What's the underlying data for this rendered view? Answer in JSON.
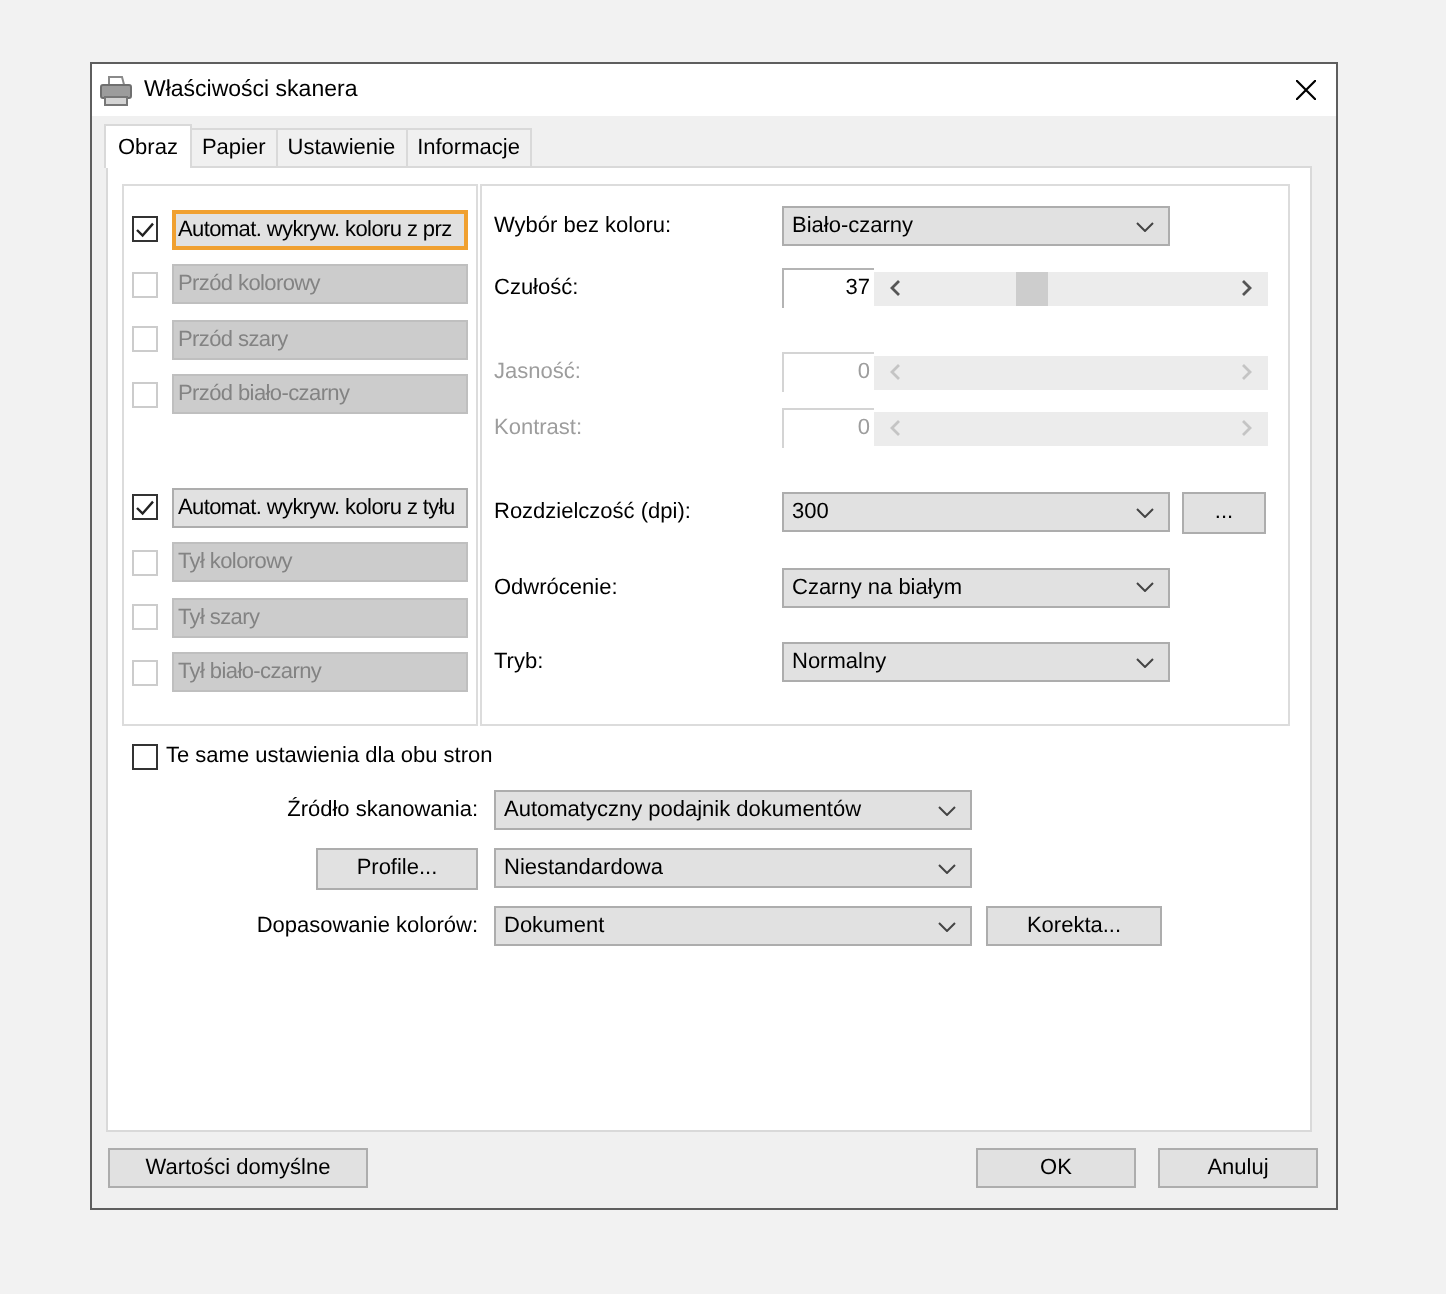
{
  "window": {
    "title": "Właściwości skanera"
  },
  "tabs": [
    {
      "label": "Obraz",
      "selected": true
    },
    {
      "label": "Papier",
      "selected": false
    },
    {
      "label": "Ustawienie",
      "selected": false
    },
    {
      "label": "Informacje",
      "selected": false
    }
  ],
  "image_types": [
    {
      "items": [
        {
          "label": "Automat. wykryw. koloru z prz",
          "checked": true,
          "disabled": false,
          "focused": true
        },
        {
          "label": "Przód kolorowy",
          "checked": false,
          "disabled": true,
          "focused": false
        },
        {
          "label": "Przód szary",
          "checked": false,
          "disabled": true,
          "focused": false
        },
        {
          "label": "Przód biało-czarny",
          "checked": false,
          "disabled": true,
          "focused": false
        }
      ]
    },
    {
      "items": [
        {
          "label": "Automat. wykryw. koloru z tyłu",
          "checked": true,
          "disabled": false,
          "focused": false
        },
        {
          "label": "Tył kolorowy",
          "checked": false,
          "disabled": true,
          "focused": false
        },
        {
          "label": "Tył szary",
          "checked": false,
          "disabled": true,
          "focused": false
        },
        {
          "label": "Tył biało-czarny",
          "checked": false,
          "disabled": true,
          "focused": false
        }
      ]
    }
  ],
  "settings": [
    {
      "rows": [
        {
          "kind": "dropdown",
          "label": "Wybór bez koloru:",
          "value": "Biało-czarny",
          "disabled": false
        },
        {
          "kind": "slider",
          "label": "Czułość:",
          "value": "37",
          "level": 0.37,
          "disabled": false
        }
      ]
    },
    {
      "rows": [
        {
          "kind": "slider",
          "label": "Jasność:",
          "value": "0",
          "disabled": true
        },
        {
          "kind": "slider",
          "label": "Kontrast:",
          "value": "0",
          "disabled": true
        }
      ]
    },
    {
      "rows": [
        {
          "kind": "dropdown",
          "label": "Rozdzielczość (dpi):",
          "value": "300",
          "button": "...",
          "disabled": false
        },
        {
          "kind": "dropdown",
          "label": "Odwrócenie:",
          "value": "Czarny na białym",
          "disabled": false
        },
        {
          "kind": "dropdown",
          "label": "Tryb:",
          "value": "Normalny",
          "disabled": false
        }
      ]
    }
  ],
  "both_sides": {
    "label": "Te same ustawienia dla obu stron",
    "checked": false
  },
  "scan_options": [
    {
      "kind": "label",
      "label": "Źródło skanowania:",
      "value": "Automatyczny podajnik dokumentów"
    },
    {
      "kind": "button",
      "label": "Profile...",
      "value": "Niestandardowa"
    },
    {
      "kind": "label",
      "label": "Dopasowanie kolorów:",
      "value": "Dokument",
      "button": "Korekta..."
    }
  ],
  "footer": {
    "left_buttons": [
      "Wartości domyślne"
    ],
    "right_buttons": [
      "OK",
      "Anuluj"
    ]
  }
}
